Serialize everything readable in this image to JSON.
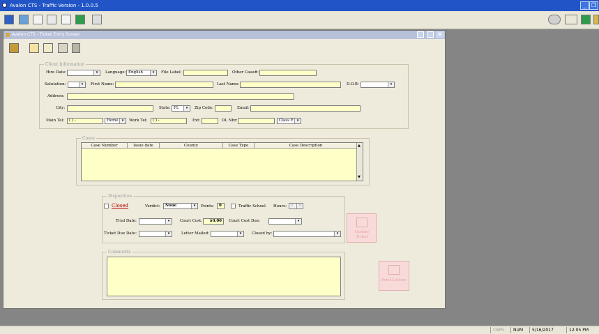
{
  "app": {
    "title": "Avalon CTS - Traffic Version - 1.0.0.5"
  },
  "child_window": {
    "title": "Avalon CTS - Ticket Entry Screen"
  },
  "colors": {
    "title_bar": "#2155c7",
    "field_bg": "#ffffc8",
    "panel_bg": "#efebdc",
    "disabled_button": "#f8dada"
  },
  "client": {
    "legend": "Client Information",
    "hire_date_label": "Hire Date:",
    "language_label": "Language:",
    "language_value": "English",
    "file_label_label": "File Label:",
    "other_case_label": "Other Case#:",
    "salutation_label": "Salutation:",
    "first_name_label": "First Name:",
    "last_name_label": "Last Name:",
    "dob_label": "D.O.B:",
    "address_label": "Address:",
    "city_label": "City:",
    "state_label": "State:",
    "state_value": "FL",
    "zip_label": "Zip Code:",
    "email_label": "Email:",
    "main_tel_label": "Main Tel:",
    "main_tel_value": "( )  -",
    "main_tel_type": "Home",
    "work_tel_label": "Work Tel:",
    "work_tel_value": "( )  -",
    "ext_label": "Ext:",
    "dl_label": "DL Nbr:",
    "dl_class_value": "Class E"
  },
  "cases": {
    "legend": "Cases",
    "columns": [
      "Case Number",
      "Issue date",
      "County",
      "Case Type",
      "Case Description"
    ]
  },
  "disposition": {
    "legend": "Disposition",
    "closed_label": "Closed",
    "verdict_label": "Verdict:",
    "verdict_value": "None",
    "points_label": "Points:",
    "points_value": "0",
    "traffic_school_label": "Traffic School",
    "hours_label": "Hours:",
    "hours_value": "0",
    "trial_date_label": "Trial Date:",
    "court_cost_label": "Court Cost:",
    "court_cost_value": "$0.00",
    "court_cost_due_label": "Court Cost Due:",
    "ticket_due_label": "Ticket Due Date:",
    "letter_mailed_label": "Letter Mailed:",
    "closed_by_label": "Closed by:"
  },
  "buttons": {
    "update_ticket": "Update Ticket",
    "print_letters": "Print Letters"
  },
  "comments": {
    "legend": "Comments"
  },
  "status": {
    "caps": "CAPS",
    "num": "NUM",
    "date": "5/16/2017",
    "time": "12:05 PM"
  }
}
